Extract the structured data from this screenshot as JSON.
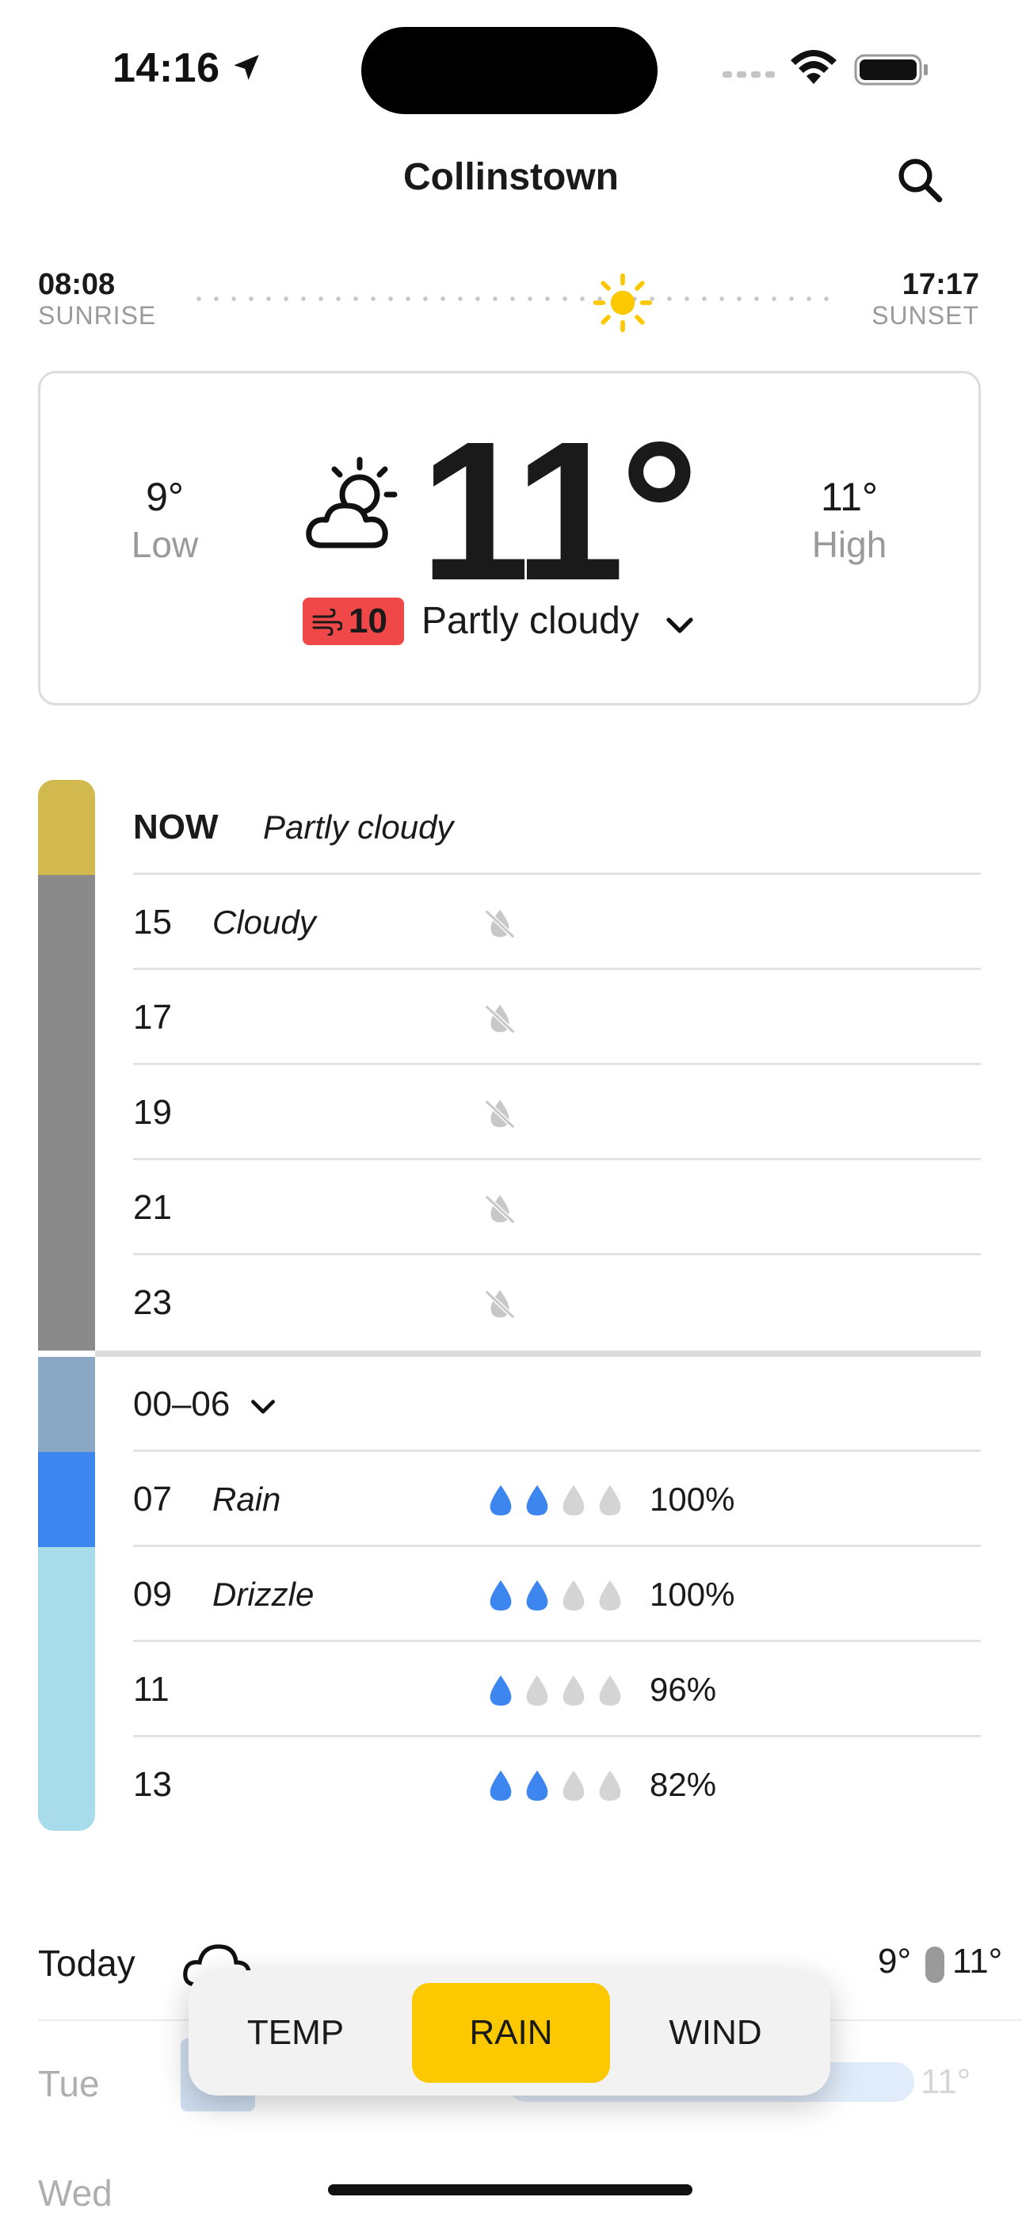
{
  "status": {
    "time": "14:16"
  },
  "header": {
    "city": "Collinstown"
  },
  "sun": {
    "sunrise_time": "08:08",
    "sunrise_label": "SUNRISE",
    "sunset_time": "17:17",
    "sunset_label": "SUNSET"
  },
  "current": {
    "low_value": "9°",
    "low_label": "Low",
    "high_value": "11°",
    "high_label": "High",
    "temp": "11°",
    "wind": "10",
    "condition": "Partly cloudy",
    "colors": {
      "wind_badge": "#f04848"
    }
  },
  "hourly": {
    "now": {
      "hour": "NOW",
      "desc": "Partly cloudy"
    },
    "rows": [
      {
        "hour": "15",
        "desc": "Cloudy"
      },
      {
        "hour": "17",
        "desc": ""
      },
      {
        "hour": "19",
        "desc": ""
      },
      {
        "hour": "21",
        "desc": ""
      },
      {
        "hour": "23",
        "desc": ""
      }
    ],
    "group": {
      "label": "00–06"
    },
    "rain_rows": [
      {
        "hour": "07",
        "desc": "Rain",
        "drops_filled": 2,
        "drops_total": 4,
        "pct": "100%"
      },
      {
        "hour": "09",
        "desc": "Drizzle",
        "drops_filled": 2,
        "drops_total": 4,
        "pct": "100%"
      },
      {
        "hour": "11",
        "desc": "",
        "drops_filled": 1,
        "drops_total": 4,
        "pct": "96%"
      },
      {
        "hour": "13",
        "desc": "",
        "drops_filled": 2,
        "drops_total": 4,
        "pct": "82%"
      }
    ],
    "bar_colors": {
      "now": "#d1b94f",
      "cloudy": "#8a8a8a",
      "night": "#8aa8c4",
      "rain": "#3d86f0",
      "drizzle": "#a9dceb"
    }
  },
  "daily": [
    {
      "day": "Today",
      "low": "9°",
      "high": "11°"
    },
    {
      "day": "Tue",
      "high": "11°"
    },
    {
      "day": "Wed"
    }
  ],
  "modes": {
    "temp": "TEMP",
    "rain": "RAIN",
    "wind": "WIND",
    "active": "RAIN",
    "active_color": "#fcc800"
  }
}
